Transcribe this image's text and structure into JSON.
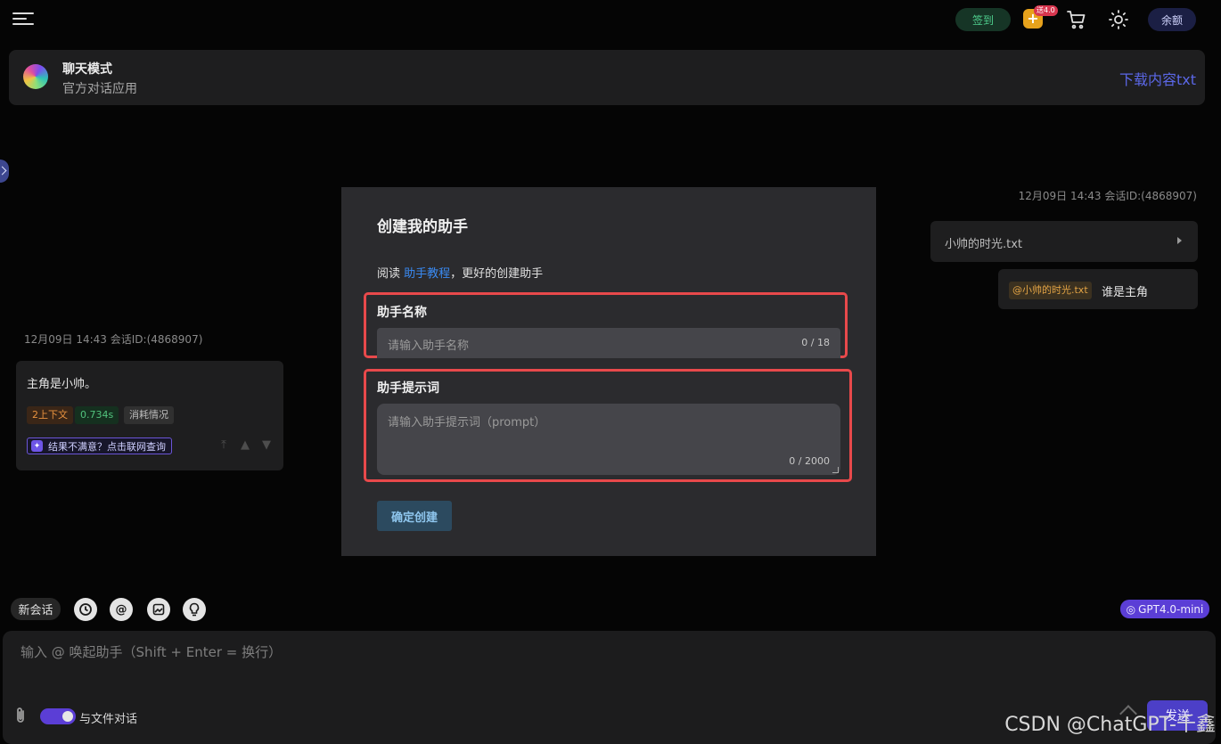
{
  "topbar": {
    "checkin_label": "签到",
    "gift_badge": "送4.0",
    "balance_label": "余额",
    "icons": [
      "menu-icon",
      "gift-icon",
      "cart-icon",
      "theme-sun-icon"
    ]
  },
  "mode": {
    "title": "聊天模式",
    "subtitle": "官方对话应用",
    "download_label": "下载内容txt"
  },
  "chat": {
    "left_meta": "12月09日 14:43 会话ID:(4868907)",
    "bot_message": "主角是小帅。",
    "tags": {
      "context": "2上下文",
      "time": "0.734s",
      "usage": "消耗情况"
    },
    "retry_label": "结果不满意？点击联网查询",
    "right_meta": "12月09日 14:43 会话ID:(4868907)",
    "file_name": "小帅的时光.txt",
    "mention": "@小帅的时光.txt",
    "user_message": "谁是主角"
  },
  "modal": {
    "title": "创建我的助手",
    "intro_prefix": "阅读 ",
    "intro_link": "助手教程",
    "intro_suffix": "，更好的创建助手",
    "name_label": "助手名称",
    "name_placeholder": "请输入助手名称",
    "name_count": "0 / 18",
    "prompt_label": "助手提示词",
    "prompt_placeholder": "请输入助手提示词（prompt）",
    "prompt_count": "0 / 2000",
    "confirm_label": "确定创建"
  },
  "toolbar": {
    "new_chat_label": "新会话",
    "tool_icons": [
      "history-icon",
      "at-icon",
      "image-icon",
      "bulb-icon"
    ],
    "model_label": "GPT4.0-mini"
  },
  "composer": {
    "placeholder": "输入 @ 唤起助手（Shift + Enter = 换行）",
    "file_chat_label": "与文件对话",
    "send_label": "发送"
  },
  "watermark": "CSDN @ChatGPT-千鑫",
  "colors": {
    "accent": "#5b3ed6",
    "highlight_border": "#e8494b",
    "link": "#3a8bf4"
  }
}
